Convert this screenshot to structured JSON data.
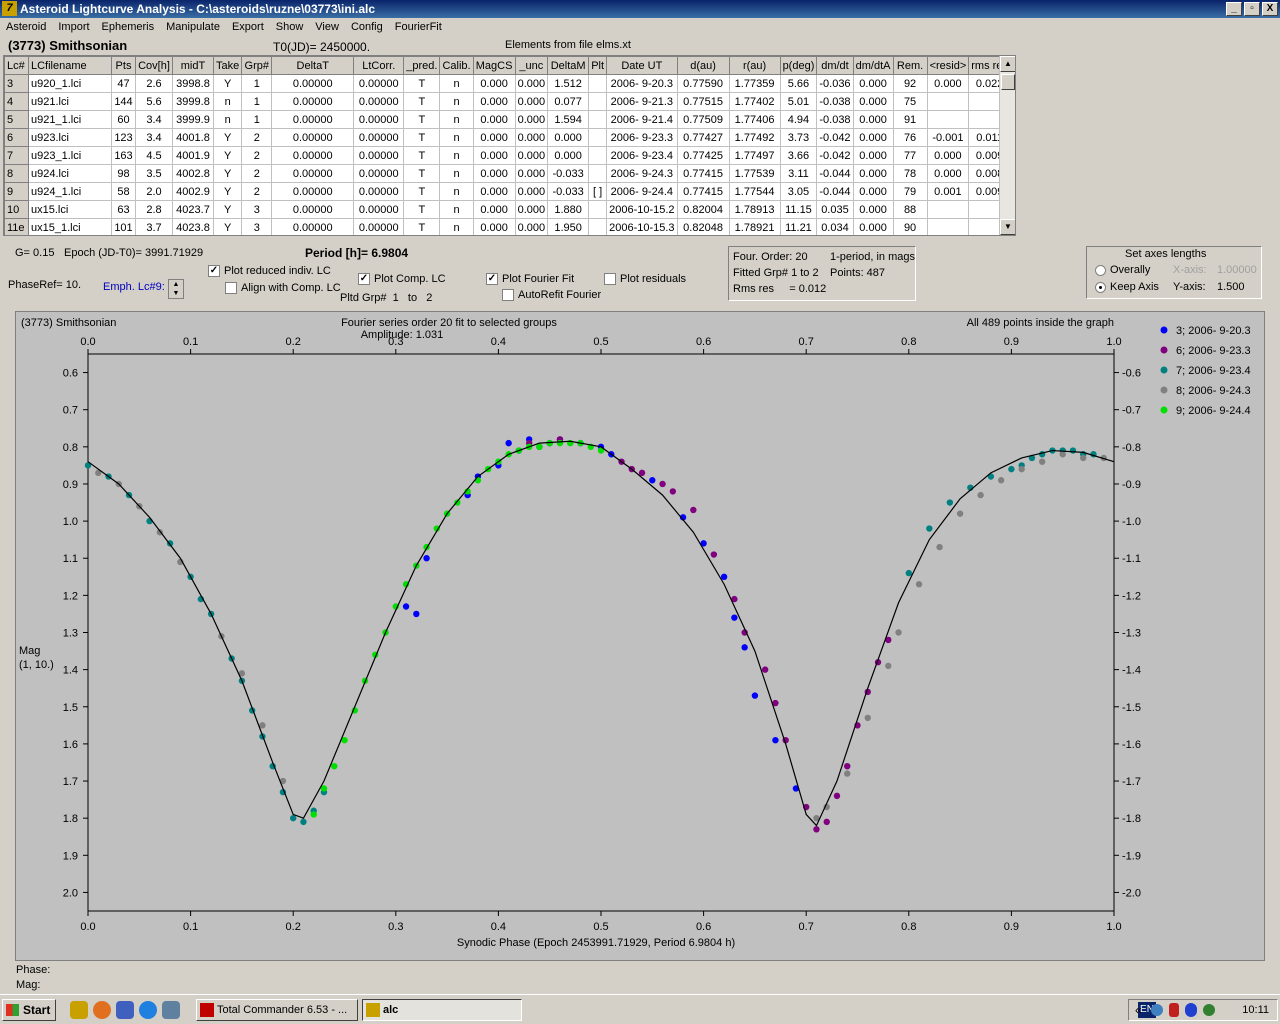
{
  "window": {
    "title": "Asteroid Lightcurve Analysis - C:\\asteroids\\ruzne\\03773\\ini.alc",
    "app_icon": "lightcurve-app-icon",
    "min_glyph": "_",
    "max_glyph": "▫",
    "close_glyph": "X"
  },
  "menu": [
    "Asteroid",
    "Import",
    "Ephemeris",
    "Manipulate",
    "Export",
    "Show",
    "View",
    "Config",
    "FourierFit"
  ],
  "header": {
    "asteroid_name": "(3773) Smithsonian",
    "t0": "T0(JD)= 2450000.",
    "elements": "Elements from file elms.xt"
  },
  "table": {
    "columns": [
      "Lc#",
      "LCfilename",
      "Pts",
      "Cov[h]",
      "midT",
      "Take",
      "Grp#",
      "DeltaT",
      "LtCorr.",
      "_pred.",
      "Calib.",
      "MagCS",
      "_unc",
      "DeltaM",
      "Plt",
      "Date UT",
      "d(au)",
      "r(au)",
      "p(deg)",
      "dm/dt",
      "dm/dtA",
      "Rem.",
      "<resid>",
      "rms res"
    ],
    "rows": [
      [
        "3",
        "u920_1.lci",
        "47",
        "2.6",
        "3998.8",
        "Y",
        "1",
        "0.00000",
        "0.00000",
        "T",
        "n",
        "0.000",
        "0.000",
        "1.512",
        "",
        "2006- 9-20.3",
        "0.77590",
        "1.77359",
        "5.66",
        "-0.036",
        "0.000",
        "92",
        "0.000",
        "0.022"
      ],
      [
        "4",
        "u921.lci",
        "144",
        "5.6",
        "3999.8",
        "n",
        "1",
        "0.00000",
        "0.00000",
        "T",
        "n",
        "0.000",
        "0.000",
        "0.077",
        "",
        "2006- 9-21.3",
        "0.77515",
        "1.77402",
        "5.01",
        "-0.038",
        "0.000",
        "75",
        "",
        ""
      ],
      [
        "5",
        "u921_1.lci",
        "60",
        "3.4",
        "3999.9",
        "n",
        "1",
        "0.00000",
        "0.00000",
        "T",
        "n",
        "0.000",
        "0.000",
        "1.594",
        "",
        "2006- 9-21.4",
        "0.77509",
        "1.77406",
        "4.94",
        "-0.038",
        "0.000",
        "91",
        "",
        ""
      ],
      [
        "6",
        "u923.lci",
        "123",
        "3.4",
        "4001.8",
        "Y",
        "2",
        "0.00000",
        "0.00000",
        "T",
        "n",
        "0.000",
        "0.000",
        "0.000",
        "",
        "2006- 9-23.3",
        "0.77427",
        "1.77492",
        "3.73",
        "-0.042",
        "0.000",
        "76",
        "-0.001",
        "0.011"
      ],
      [
        "7",
        "u923_1.lci",
        "163",
        "4.5",
        "4001.9",
        "Y",
        "2",
        "0.00000",
        "0.00000",
        "T",
        "n",
        "0.000",
        "0.000",
        "0.000",
        "",
        "2006- 9-23.4",
        "0.77425",
        "1.77497",
        "3.66",
        "-0.042",
        "0.000",
        "77",
        "0.000",
        "0.009"
      ],
      [
        "8",
        "u924.lci",
        "98",
        "3.5",
        "4002.8",
        "Y",
        "2",
        "0.00000",
        "0.00000",
        "T",
        "n",
        "0.000",
        "0.000",
        "-0.033",
        "",
        "2006- 9-24.3",
        "0.77415",
        "1.77539",
        "3.11",
        "-0.044",
        "0.000",
        "78",
        "0.000",
        "0.008"
      ],
      [
        "9",
        "u924_1.lci",
        "58",
        "2.0",
        "4002.9",
        "Y",
        "2",
        "0.00000",
        "0.00000",
        "T",
        "n",
        "0.000",
        "0.000",
        "-0.033",
        "[ ]",
        "2006- 9-24.4",
        "0.77415",
        "1.77544",
        "3.05",
        "-0.044",
        "0.000",
        "79",
        "0.001",
        "0.009"
      ],
      [
        "10",
        "ux15.lci",
        "63",
        "2.8",
        "4023.7",
        "Y",
        "3",
        "0.00000",
        "0.00000",
        "T",
        "n",
        "0.000",
        "0.000",
        "1.880",
        "",
        "2006-10-15.2",
        "0.82004",
        "1.78913",
        "11.15",
        "0.035",
        "0.000",
        "88",
        "",
        ""
      ],
      [
        "11e",
        "ux15_1.lci",
        "101",
        "3.7",
        "4023.8",
        "Y",
        "3",
        "0.00000",
        "0.00000",
        "T",
        "n",
        "0.000",
        "0.000",
        "1.950",
        "",
        "2006-10-15.3",
        "0.82048",
        "1.78921",
        "11.21",
        "0.034",
        "0.000",
        "90",
        "",
        ""
      ]
    ]
  },
  "params": {
    "g": "G= 0.15",
    "epoch": "Epoch (JD-T0)= 3991.71929",
    "period": "Period [h]= 6.9804",
    "phase_ref": "PhaseRef= 10.",
    "emph_lc": "Emph. Lc#9:"
  },
  "options": {
    "plot_reduced": {
      "label": "Plot reduced indiv. LC",
      "checked": true
    },
    "align_comp": {
      "label": "Align with Comp. LC",
      "checked": false
    },
    "plot_comp": {
      "label": "Plot Comp. LC",
      "checked": true
    },
    "pltd_grp_label": "Pltd Grp#",
    "pltd_grp_from": "1",
    "pltd_grp_to_label": "to",
    "pltd_grp_to": "2",
    "plot_fourier": {
      "label": "Plot Fourier Fit",
      "checked": true
    },
    "autorefit": {
      "label": "AutoRefit Fourier",
      "checked": false
    },
    "plot_residuals": {
      "label": "Plot residuals",
      "checked": false
    },
    "check_glyph": "✓"
  },
  "fourier_info": {
    "order": "Four. Order: 20",
    "mode": "1-period, in mags",
    "fitted": "Fitted Grp# 1 to 2",
    "points": "Points: 487",
    "rms": "Rms res     = 0.012"
  },
  "axes_panel": {
    "title": "Set axes lengths",
    "overally": "Overally",
    "keep_axis": "Keep Axis",
    "x_label": "X-axis:",
    "x_value": "1.00000",
    "y_label": "Y-axis:",
    "y_value": "1.500",
    "selected": "keep_axis"
  },
  "status": {
    "phase_label": "Phase:",
    "mag_label": "Mag:"
  },
  "chart_data": {
    "type": "scatter",
    "title": "Fourier series order 20 fit to selected groups",
    "subtitle": "Amplitude: 1.031",
    "object_label": "(3773) Smithsonian",
    "note": "All 489 points inside the graph",
    "xlabel": "Synodic Phase (Epoch 2453991.71929, Period 6.9804 h)",
    "ylabel": "Mag",
    "ylabel2": "(1, 10.)",
    "xlim": [
      0,
      1
    ],
    "ylim": [
      2.05,
      0.55
    ],
    "y_inverted": true,
    "x_ticks": [
      "0.0",
      "0.1",
      "0.2",
      "0.3",
      "0.4",
      "0.5",
      "0.6",
      "0.7",
      "0.8",
      "0.9",
      "1.0"
    ],
    "y_ticks": [
      "0.6",
      "0.7",
      "0.8",
      "0.9",
      "1.0",
      "1.1",
      "1.2",
      "1.3",
      "1.4",
      "1.5",
      "1.6",
      "1.7",
      "1.8",
      "1.9",
      "2.0"
    ],
    "y_ticks_right": [
      "-0.6",
      "-0.7",
      "-0.8",
      "-0.9",
      "-1.0",
      "-1.1",
      "-1.2",
      "-1.3",
      "-1.4",
      "-1.5",
      "-1.6",
      "-1.7",
      "-1.8",
      "-1.9",
      "-2.0"
    ],
    "legend_position": "right",
    "fit_curve": {
      "x": [
        0.0,
        0.03,
        0.06,
        0.09,
        0.12,
        0.15,
        0.18,
        0.2,
        0.21,
        0.23,
        0.26,
        0.29,
        0.32,
        0.35,
        0.38,
        0.41,
        0.44,
        0.47,
        0.5,
        0.53,
        0.56,
        0.59,
        0.62,
        0.65,
        0.68,
        0.7,
        0.71,
        0.73,
        0.76,
        0.79,
        0.82,
        0.85,
        0.88,
        0.91,
        0.94,
        0.97,
        1.0
      ],
      "y": [
        0.84,
        0.9,
        0.99,
        1.1,
        1.25,
        1.43,
        1.65,
        1.79,
        1.8,
        1.7,
        1.5,
        1.3,
        1.12,
        0.98,
        0.88,
        0.82,
        0.79,
        0.785,
        0.8,
        0.86,
        0.93,
        1.03,
        1.17,
        1.35,
        1.6,
        1.79,
        1.82,
        1.7,
        1.45,
        1.22,
        1.05,
        0.94,
        0.87,
        0.83,
        0.81,
        0.815,
        0.84
      ]
    },
    "series": [
      {
        "name": "3; 2006- 9-20.3",
        "color": "#0000ff",
        "x": [
          0.4,
          0.41,
          0.42,
          0.43,
          0.44,
          0.45,
          0.46,
          0.48,
          0.5,
          0.51,
          0.55,
          0.58,
          0.6,
          0.62,
          0.63,
          0.64,
          0.65,
          0.67,
          0.69,
          0.31,
          0.32,
          0.33,
          0.37,
          0.38
        ],
        "y": [
          0.85,
          0.79,
          0.81,
          0.78,
          0.8,
          0.79,
          0.78,
          0.79,
          0.8,
          0.82,
          0.89,
          0.99,
          1.06,
          1.15,
          1.26,
          1.34,
          1.47,
          1.59,
          1.72,
          1.23,
          1.25,
          1.1,
          0.93,
          0.88
        ]
      },
      {
        "name": "6; 2006- 9-23.3",
        "color": "#800080",
        "x": [
          0.52,
          0.53,
          0.54,
          0.56,
          0.57,
          0.59,
          0.61,
          0.63,
          0.64,
          0.66,
          0.67,
          0.68,
          0.7,
          0.71,
          0.72,
          0.73,
          0.74,
          0.75,
          0.76,
          0.77,
          0.78,
          0.43,
          0.46
        ],
        "y": [
          0.84,
          0.86,
          0.87,
          0.9,
          0.92,
          0.97,
          1.09,
          1.21,
          1.3,
          1.4,
          1.49,
          1.59,
          1.77,
          1.83,
          1.81,
          1.74,
          1.66,
          1.55,
          1.46,
          1.38,
          1.32,
          0.79,
          0.78
        ]
      },
      {
        "name": "7; 2006- 9-23.4",
        "color": "#008080",
        "x": [
          0.0,
          0.02,
          0.04,
          0.06,
          0.08,
          0.1,
          0.11,
          0.12,
          0.14,
          0.15,
          0.16,
          0.17,
          0.18,
          0.19,
          0.2,
          0.21,
          0.22,
          0.23,
          0.9,
          0.91,
          0.92,
          0.93,
          0.94,
          0.95,
          0.96,
          0.97,
          0.98,
          0.8,
          0.82,
          0.84,
          0.86,
          0.88
        ],
        "y": [
          0.85,
          0.88,
          0.93,
          1.0,
          1.06,
          1.15,
          1.21,
          1.25,
          1.37,
          1.43,
          1.51,
          1.58,
          1.66,
          1.73,
          1.8,
          1.81,
          1.78,
          1.73,
          0.86,
          0.85,
          0.83,
          0.82,
          0.81,
          0.81,
          0.81,
          0.82,
          0.82,
          1.14,
          1.02,
          0.95,
          0.91,
          0.88
        ]
      },
      {
        "name": "8; 2006- 9-24.3",
        "color": "#808080",
        "x": [
          0.01,
          0.03,
          0.05,
          0.07,
          0.09,
          0.13,
          0.15,
          0.17,
          0.19,
          0.71,
          0.72,
          0.74,
          0.76,
          0.78,
          0.79,
          0.81,
          0.83,
          0.85,
          0.87,
          0.89,
          0.91,
          0.93,
          0.95,
          0.97,
          0.99
        ],
        "y": [
          0.87,
          0.9,
          0.96,
          1.03,
          1.11,
          1.31,
          1.41,
          1.55,
          1.7,
          1.8,
          1.77,
          1.68,
          1.53,
          1.39,
          1.3,
          1.17,
          1.07,
          0.98,
          0.93,
          0.89,
          0.86,
          0.84,
          0.82,
          0.83,
          0.83
        ]
      },
      {
        "name": "9; 2006- 9-24.4",
        "color": "#00e000",
        "x": [
          0.22,
          0.23,
          0.24,
          0.25,
          0.26,
          0.27,
          0.28,
          0.29,
          0.3,
          0.31,
          0.32,
          0.33,
          0.34,
          0.35,
          0.36,
          0.37,
          0.38,
          0.39,
          0.4,
          0.41,
          0.42,
          0.43,
          0.44,
          0.45,
          0.46,
          0.47,
          0.48,
          0.49,
          0.5
        ],
        "y": [
          1.79,
          1.72,
          1.66,
          1.59,
          1.51,
          1.43,
          1.36,
          1.3,
          1.23,
          1.17,
          1.12,
          1.07,
          1.02,
          0.98,
          0.95,
          0.92,
          0.89,
          0.86,
          0.84,
          0.82,
          0.81,
          0.8,
          0.8,
          0.79,
          0.79,
          0.79,
          0.79,
          0.8,
          0.81
        ]
      }
    ]
  },
  "taskbar": {
    "start": "Start",
    "task1": "Total Commander 6.53 - ...",
    "task2": "alc",
    "lang": "EN",
    "tray_arrows": "«",
    "clock": "10:11"
  }
}
